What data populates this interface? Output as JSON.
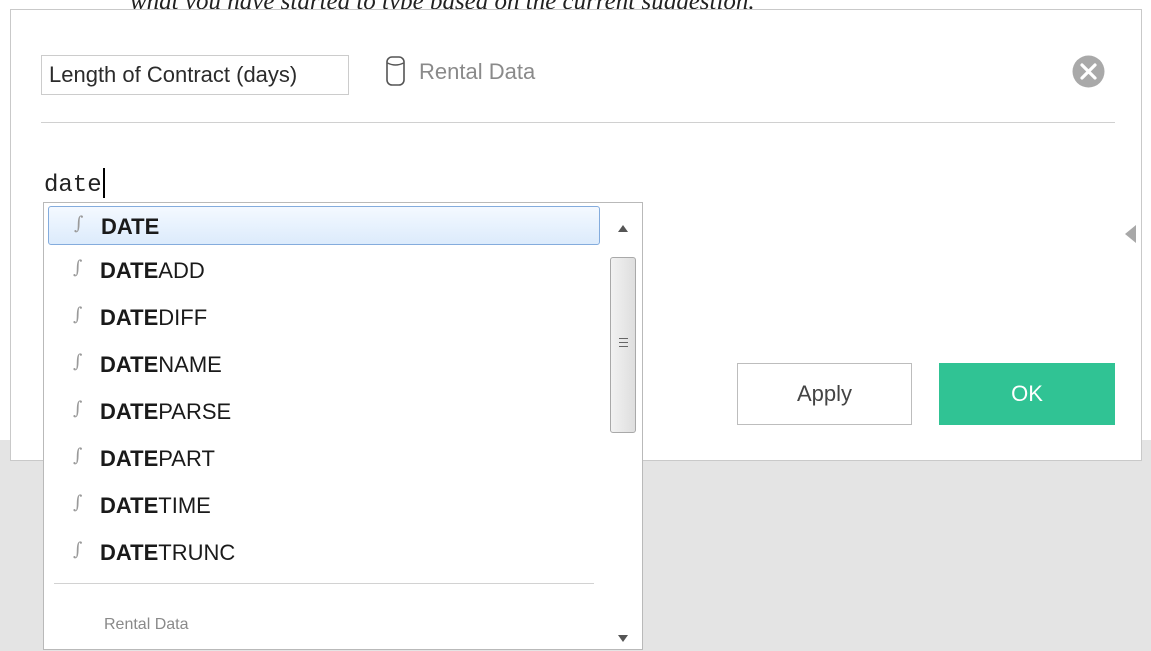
{
  "caption": "what you have started to type based on the current suggestion.",
  "dialog": {
    "calc_name": "Length of Contract (days)",
    "datasource_icon": "database-cylinder-icon",
    "datasource_label": "Rental Data",
    "close_icon": "close-circle-icon",
    "formula_text": "date",
    "expand_arrow_icon": "triangle-left-icon",
    "apply_label": "Apply",
    "ok_label": "OK",
    "ok_color": "#30c394"
  },
  "autocomplete": {
    "function_icon": "function-icon",
    "items": [
      {
        "match": "DATE",
        "rest": "",
        "selected": true
      },
      {
        "match": "DATE",
        "rest": "ADD"
      },
      {
        "match": "DATE",
        "rest": "DIFF"
      },
      {
        "match": "DATE",
        "rest": "NAME"
      },
      {
        "match": "DATE",
        "rest": "PARSE"
      },
      {
        "match": "DATE",
        "rest": "PART"
      },
      {
        "match": "DATE",
        "rest": "TIME"
      },
      {
        "match": "DATE",
        "rest": "TRUNC"
      }
    ],
    "section_label": "Rental Data"
  }
}
